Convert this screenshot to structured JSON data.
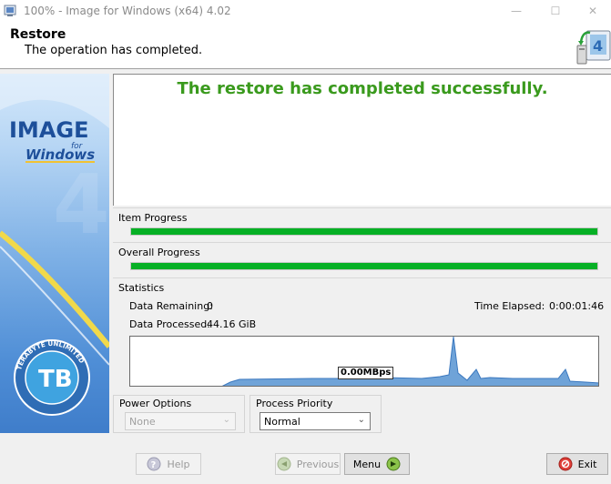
{
  "window": {
    "title": "100% - Image for Windows (x64) 4.02"
  },
  "header": {
    "title": "Restore",
    "subtitle": "The operation has completed."
  },
  "banner": {
    "logo_line1": "IMAGE",
    "logo_for": "for",
    "logo_line2": "Windows",
    "seal_text": "TERABYTE UNLIMITED"
  },
  "message": {
    "text": "The restore has completed successfully."
  },
  "item_progress": {
    "label": "Item Progress",
    "value": 1.0
  },
  "overall_progress": {
    "label": "Overall Progress",
    "value": 1.0
  },
  "statistics": {
    "label": "Statistics",
    "data_remaining_label": "Data Remaining:",
    "data_remaining_value": "0",
    "data_processed_label": "Data Processed:",
    "data_processed_value": "44.16 GiB",
    "time_elapsed_label": "Time Elapsed:",
    "time_elapsed_value": "0:00:01:46",
    "rate": "0.00MBps"
  },
  "power_options": {
    "label": "Power Options",
    "value": "None"
  },
  "process_priority": {
    "label": "Process Priority",
    "value": "Normal"
  },
  "buttons": {
    "help": "Help",
    "previous": "Previous",
    "menu": "Menu",
    "exit": "Exit"
  },
  "colors": {
    "progress": "#06b025",
    "message": "#3a9a1d",
    "graph_fill": "#6fa3d8"
  }
}
